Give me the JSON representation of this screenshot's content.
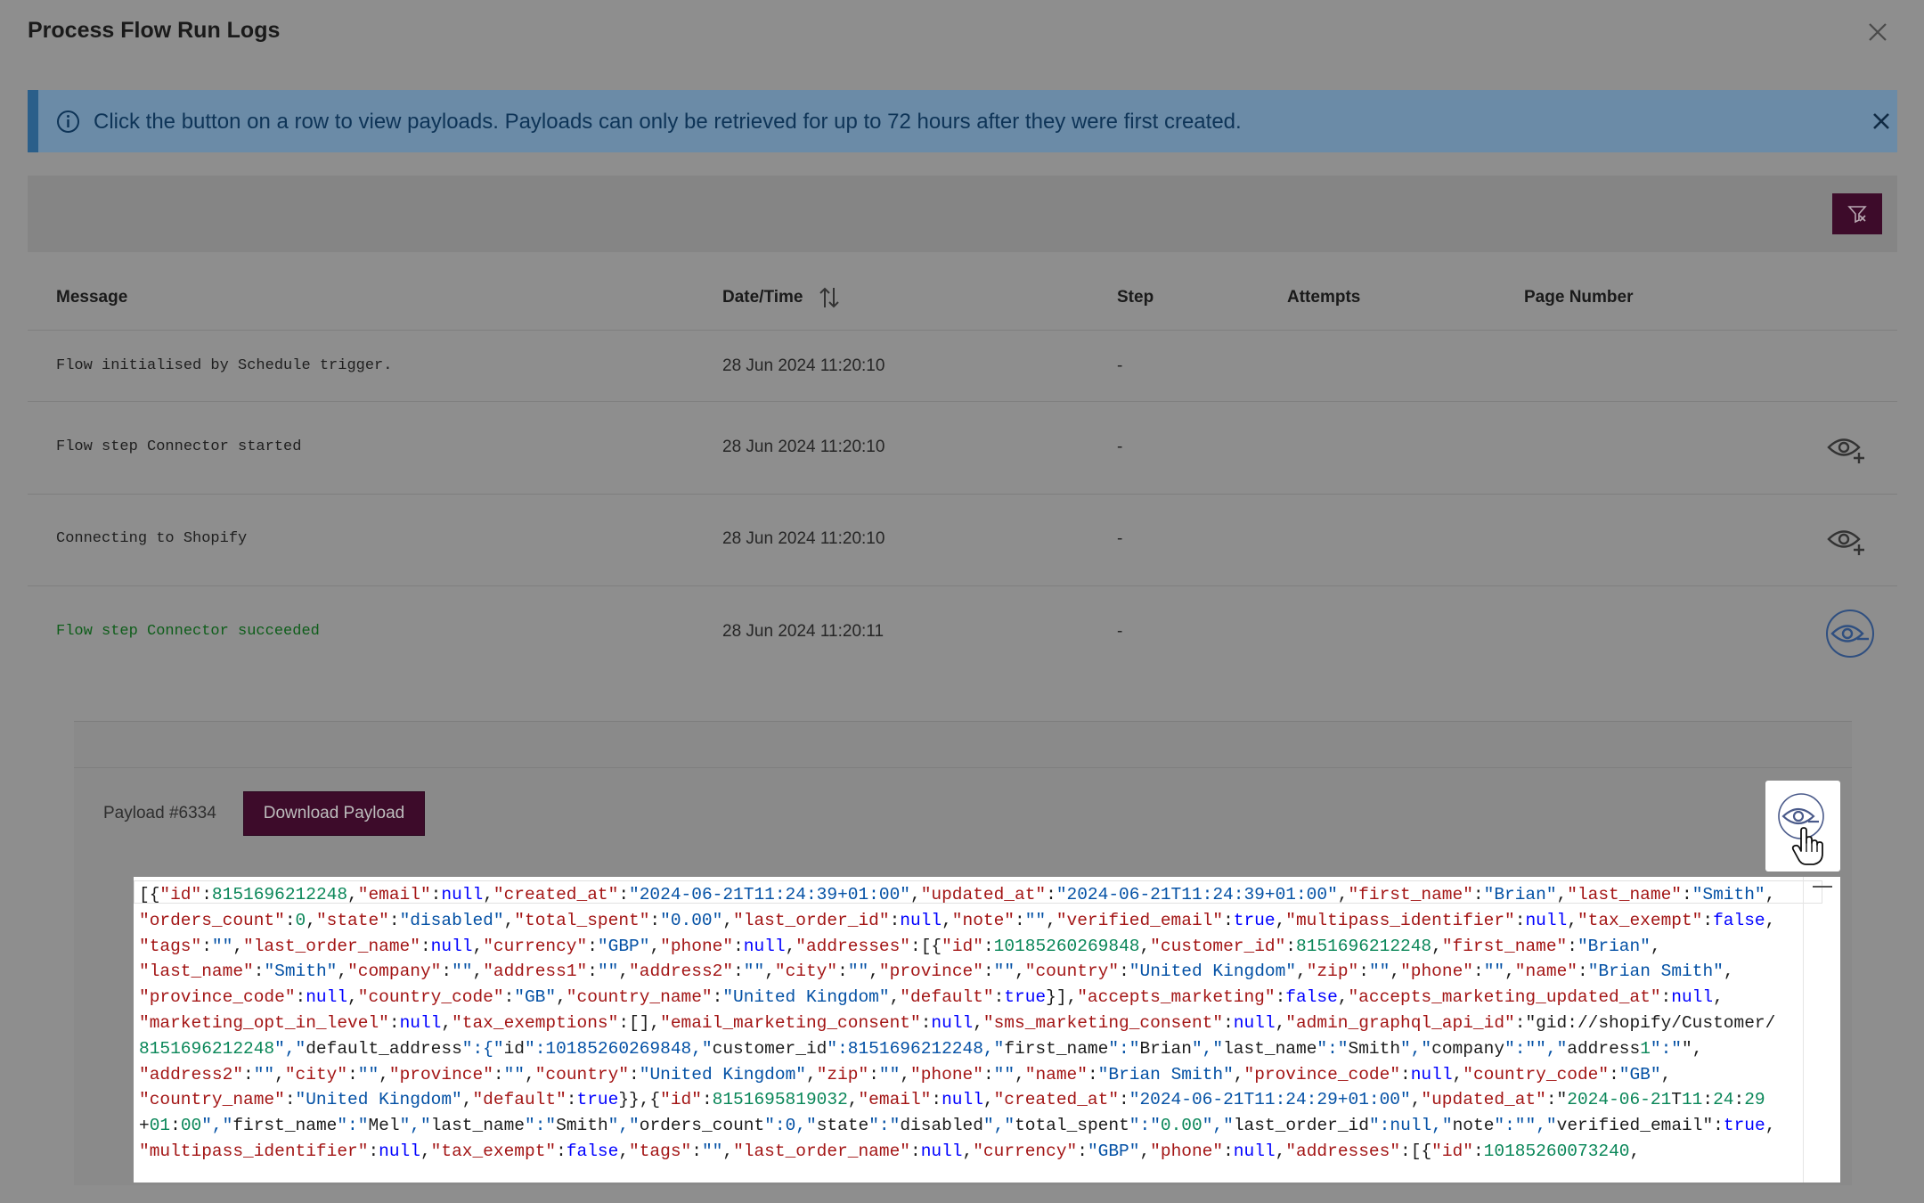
{
  "modal": {
    "title": "Process Flow Run Logs",
    "close_icon": "close-icon"
  },
  "banner": {
    "icon": "info-icon",
    "text": "Click the button on a row to view payloads. Payloads can only be retrieved for up to 72 hours after they were first created.",
    "close_icon": "close-icon",
    "accent": "#2b5f8a"
  },
  "filter": {
    "icon": "filter-clear-icon"
  },
  "table": {
    "columns": [
      "Message",
      "Date/Time",
      "Step",
      "Attempts",
      "Page Number"
    ],
    "rows": [
      {
        "message": "Flow initialised by Schedule trigger.",
        "datetime": "28 Jun 2024 11:20:10",
        "step": "-"
      },
      {
        "message": "Flow step Connector started",
        "datetime": "28 Jun 2024 11:20:10",
        "step": "-",
        "action_icon": "view-payload-icon"
      },
      {
        "message": "Connecting to Shopify",
        "datetime": "28 Jun 2024 11:20:10",
        "step": "-",
        "action_icon": "view-payload-icon"
      },
      {
        "message": "Flow step Connector succeeded",
        "datetime": "28 Jun 2024 11:20:11",
        "step": "-",
        "action_icon": "hide-payload-icon",
        "status": "success"
      }
    ]
  },
  "payload": {
    "label": "Payload #6334",
    "download_label": "Download Payload",
    "hide_icon": "hide-payload-icon",
    "code_lines": [
      "[{\"id\":8151696212248,\"email\":null,\"created_at\":\"2024-06-21T11:24:39+01:00\",\"updated_at\":\"2024-06-21T11:24:39+01:00\",\"first_name\":\"Brian\",\"last_name\":\"Smith\",",
      "\"orders_count\":0,\"state\":\"disabled\",\"total_spent\":\"0.00\",\"last_order_id\":null,\"note\":\"\",\"verified_email\":true,\"multipass_identifier\":null,\"tax_exempt\":false,",
      "\"tags\":\"\",\"last_order_name\":null,\"currency\":\"GBP\",\"phone\":null,\"addresses\":[{\"id\":10185260269848,\"customer_id\":8151696212248,\"first_name\":\"Brian\",",
      "\"last_name\":\"Smith\",\"company\":\"\",\"address1\":\"\",\"address2\":\"\",\"city\":\"\",\"province\":\"\",\"country\":\"United Kingdom\",\"zip\":\"\",\"phone\":\"\",\"name\":\"Brian Smith\",",
      "\"province_code\":null,\"country_code\":\"GB\",\"country_name\":\"United Kingdom\",\"default\":true}],\"accepts_marketing\":false,\"accepts_marketing_updated_at\":null,",
      "\"marketing_opt_in_level\":null,\"tax_exemptions\":[],\"email_marketing_consent\":null,\"sms_marketing_consent\":null,\"admin_graphql_api_id\":\"gid://shopify/Customer/",
      "8151696212248\",\"default_address\":{\"id\":10185260269848,\"customer_id\":8151696212248,\"first_name\":\"Brian\",\"last_name\":\"Smith\",\"company\":\"\",\"address1\":\"\",",
      "\"address2\":\"\",\"city\":\"\",\"province\":\"\",\"country\":\"United Kingdom\",\"zip\":\"\",\"phone\":\"\",\"name\":\"Brian Smith\",\"province_code\":null,\"country_code\":\"GB\",",
      "\"country_name\":\"United Kingdom\",\"default\":true}},{\"id\":8151695819032,\"email\":null,\"created_at\":\"2024-06-21T11:24:29+01:00\",\"updated_at\":\"2024-06-21T11:24:29",
      "+01:00\",\"first_name\":\"Mel\",\"last_name\":\"Smith\",\"orders_count\":0,\"state\":\"disabled\",\"total_spent\":\"0.00\",\"last_order_id\":null,\"note\":\"\",\"verified_email\":true,",
      "\"multipass_identifier\":null,\"tax_exempt\":false,\"tags\":\"\",\"last_order_name\":null,\"currency\":\"GBP\",\"phone\":null,\"addresses\":[{\"id\":10185260073240,"
    ]
  }
}
